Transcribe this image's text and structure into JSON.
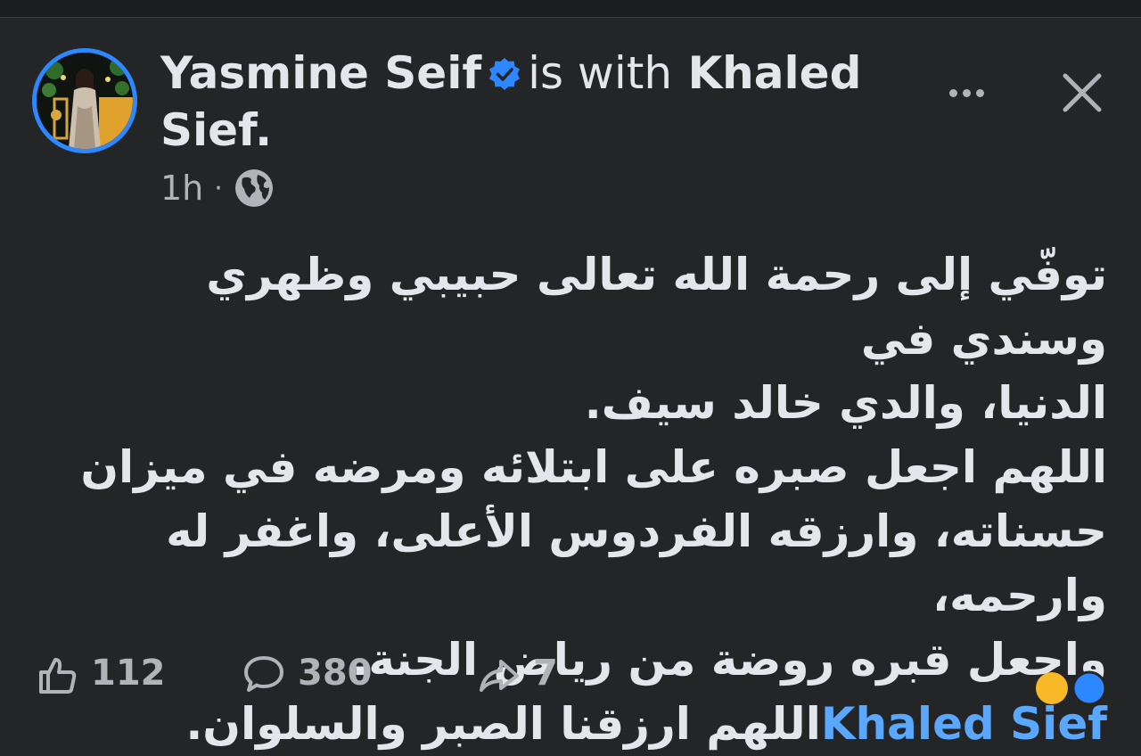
{
  "post": {
    "author": "Yasmine Seif",
    "with_text": "is with",
    "tagged": "Khaled",
    "tagged_line2": "Sief.",
    "time": "1h",
    "separator": "·",
    "audience_icon": "globe-icon",
    "body_lines": [
      "توفّي إلى رحمة الله تعالى حبيبي وظهري وسندي في",
      "الدنيا، والدي خالد سيف.",
      "اللهم اجعل صبره على ابتلائه ومرضه في ميزان",
      "حسناته، وارزقه الفردوس الأعلى، واغفر له وارحمه،",
      "واجعل قبره روضة من رياض الجنة."
    ],
    "mention": "Khaled Sief",
    "last_line": "اللهم ارزقنا الصبر والسلوان."
  },
  "stats": {
    "likes": "112",
    "comments": "380",
    "shares": "7"
  },
  "colors": {
    "background": "#242526",
    "verified": "#2d88ff",
    "link": "#5aa7ff",
    "secondary_text": "#b0b3b8"
  }
}
